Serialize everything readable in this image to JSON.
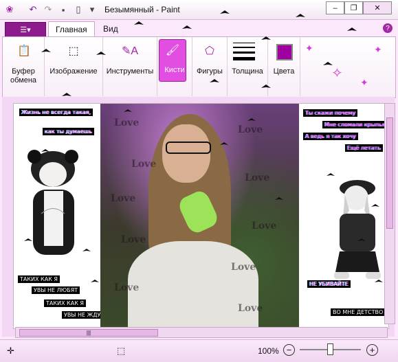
{
  "window": {
    "title": "Безымянный - Paint",
    "minimize_label": "–",
    "restore_label": "❐",
    "close_label": "✕"
  },
  "quick_access": [
    {
      "name": "app-icon",
      "glyph": "❀"
    },
    {
      "name": "undo-icon",
      "glyph": "↶"
    },
    {
      "name": "redo-icon",
      "glyph": "↷"
    },
    {
      "name": "save-icon",
      "glyph": "▪"
    },
    {
      "name": "new-icon",
      "glyph": "▯"
    },
    {
      "name": "qa-dropdown-icon",
      "glyph": "▾"
    }
  ],
  "menu": {
    "file_glyph": "☰▾",
    "tabs": [
      "Главная",
      "Вид"
    ],
    "help_glyph": "?"
  },
  "ribbon": {
    "groups": [
      {
        "label": "Буфер обмена",
        "icon": "clipboard-icon",
        "glyph": "📋"
      },
      {
        "label": "Изображение",
        "icon": "select-icon",
        "glyph": "⬚"
      },
      {
        "label": "Инструменты",
        "icon": "tools-icon",
        "glyph": "✎A"
      },
      {
        "label": "Кисти",
        "icon": "brush-icon",
        "glyph": "🖌"
      },
      {
        "label": "Фигуры",
        "icon": "shapes-icon",
        "glyph": "⬠"
      },
      {
        "label": "Толщина",
        "icon": "thickness-icon",
        "glyph": ""
      },
      {
        "label": "Цвета",
        "icon": "color-icon",
        "glyph": ""
      }
    ],
    "active_group": "Кисти",
    "accent": "#e24ee2"
  },
  "canvas": {
    "left_captions": [
      "Жизнь не всегда такая,",
      "как ты думаешь",
      "ТАКИХ КАК Я",
      "УВЫ НЕ ЛЮБЯТ",
      "ТАКИХ КАК Я",
      "УВЫ НЕ ЖДУТ"
    ],
    "right_captions": [
      "Ты скажи почему",
      "Мне сломали крылья",
      "А ведь я так хочу",
      "Ещё летать",
      "НЕ УБИВАЙТЕ",
      "ВО МНЕ ДЕТСТВО"
    ],
    "overlay_word": "Love"
  },
  "statusbar": {
    "zoom": "100%",
    "zoom_out": "−",
    "zoom_in": "+",
    "zoom_level_fraction": 0.5
  }
}
